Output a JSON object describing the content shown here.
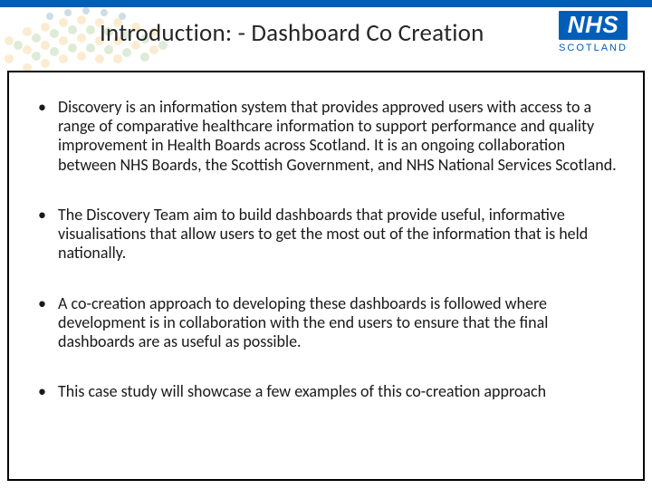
{
  "brand": {
    "name": "NHS",
    "subtext": "SCOTLAND",
    "color": "#005eb8"
  },
  "title": "Introduction: - Dashboard Co Creation",
  "bullets": [
    "Discovery is an information system that provides approved users with access to a range of comparative healthcare information to support performance and quality improvement in Health Boards across Scotland. It is an ongoing collaboration between NHS Boards, the Scottish Government, and NHS National Services Scotland.",
    "The Discovery Team aim to build dashboards that provide useful, informative visualisations that allow users to get the most out of the information that is held nationally.",
    "A co-creation approach to developing these dashboards is followed where development is in collaboration with the end users to ensure that the final dashboards are as useful as possible.",
    "This case study will showcase a few examples of this co-creation approach"
  ]
}
